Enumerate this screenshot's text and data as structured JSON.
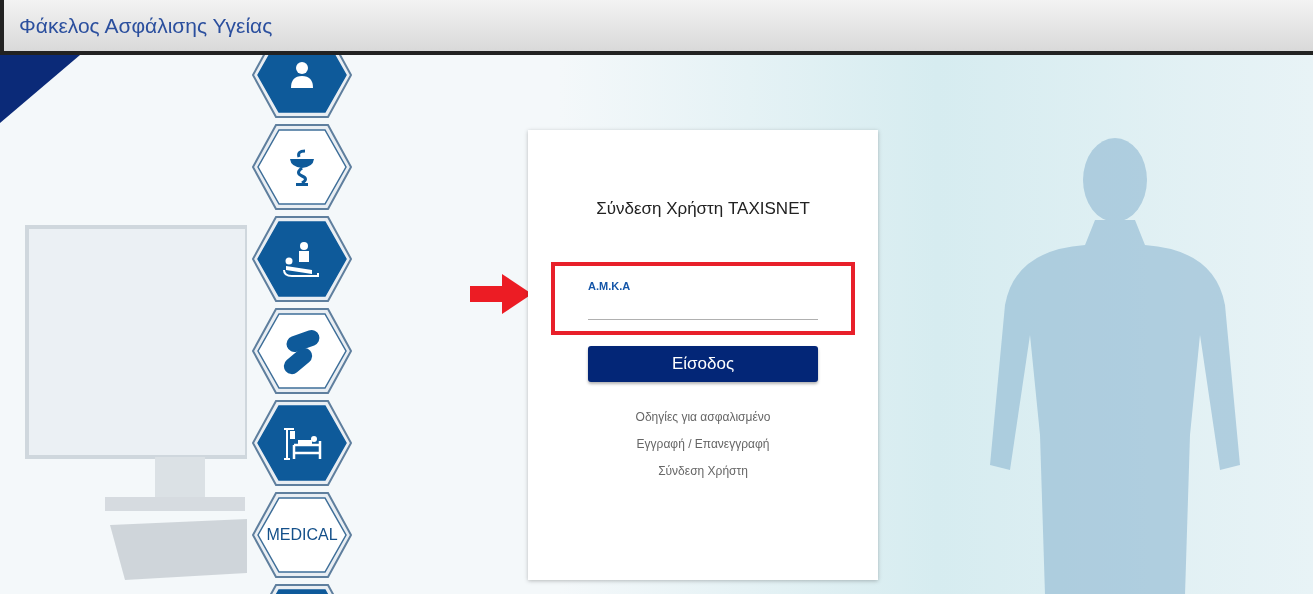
{
  "header": {
    "title": "Φάκελος Ασφάλισης Υγείας"
  },
  "hexagons": [
    {
      "kind": "doctor",
      "filled": true
    },
    {
      "kind": "pharmacy",
      "filled": false
    },
    {
      "kind": "physiotherapy",
      "filled": true
    },
    {
      "kind": "pills",
      "filled": false
    },
    {
      "kind": "hospital-bed",
      "filled": true
    },
    {
      "kind": "text",
      "filled": false,
      "label": "MEDICAL"
    },
    {
      "kind": "blank",
      "filled": true
    }
  ],
  "login": {
    "title": "Σύνδεση Χρήστη TAXISNET",
    "field": {
      "label": "Α.Μ.Κ.Α",
      "highlighted": true
    },
    "button": "Είσοδος",
    "links": [
      "Οδηγίες για ασφαλισμένο",
      "Εγγραφή / Επανεγγραφή",
      "Σύνδεση Χρήστη"
    ]
  }
}
